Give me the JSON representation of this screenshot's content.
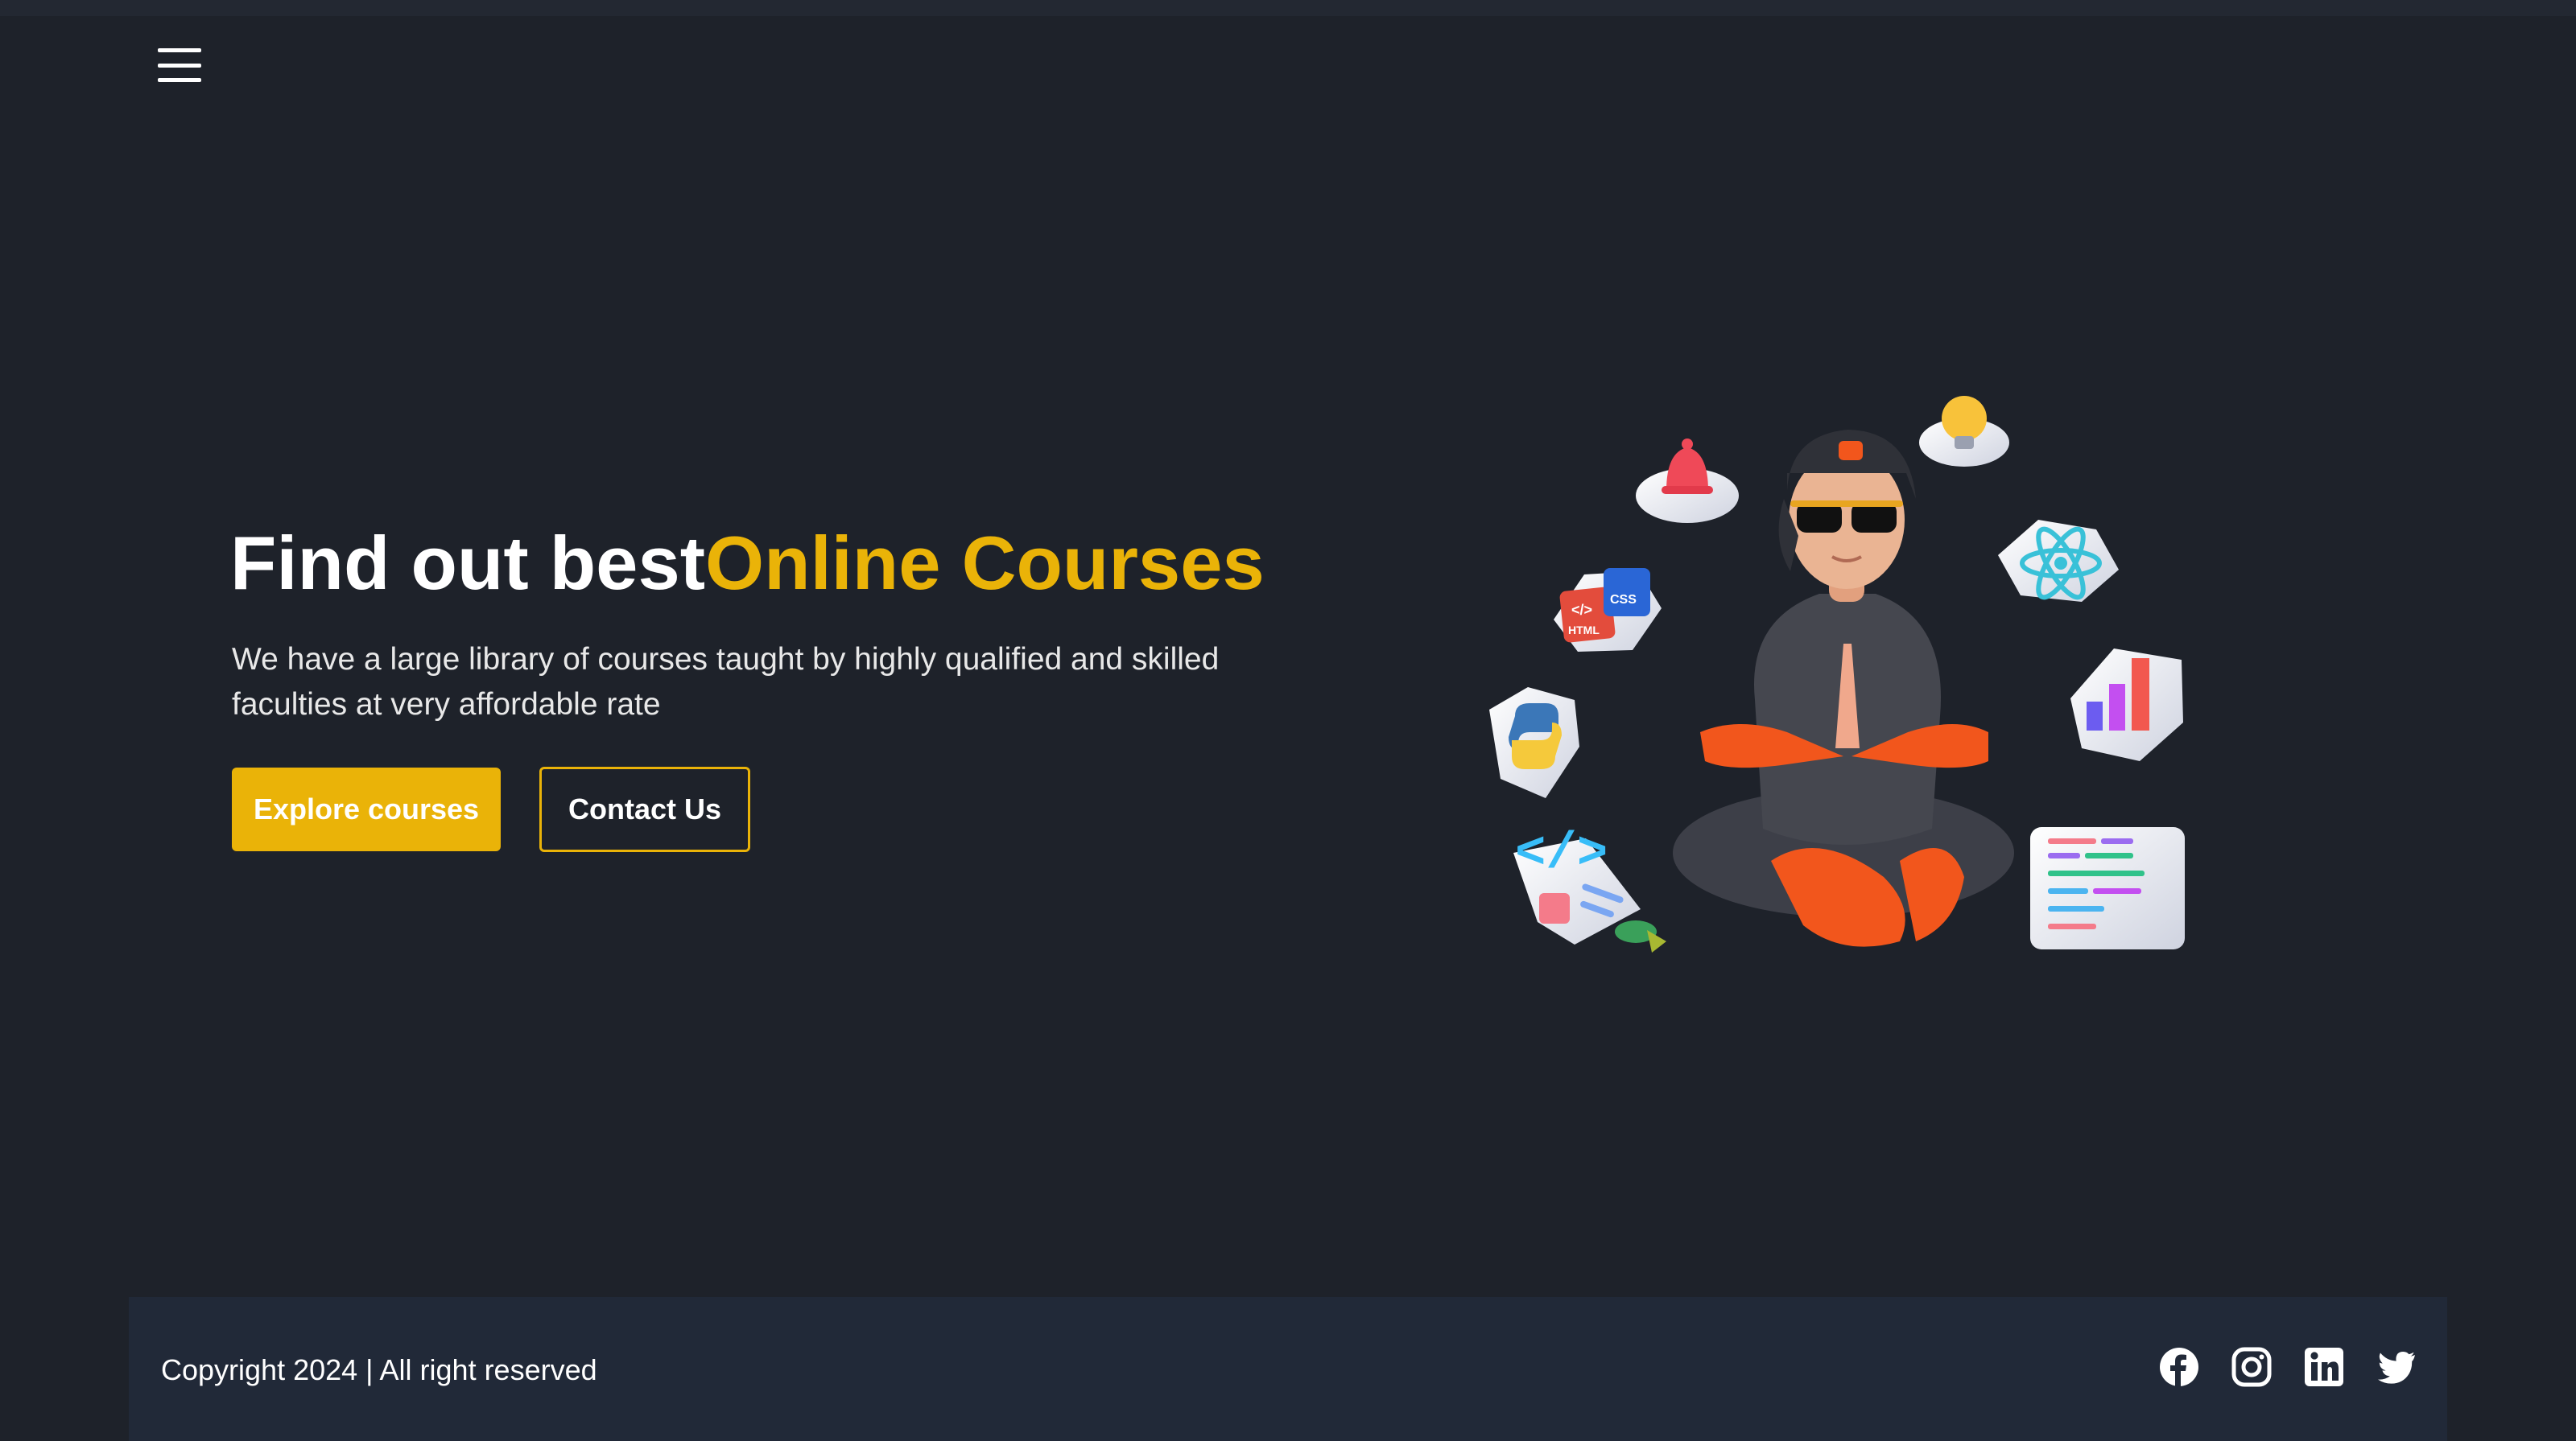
{
  "nav": {
    "menu_icon": "hamburger-icon"
  },
  "hero": {
    "title_plain": "Find out best",
    "title_accent": "Online Courses",
    "description": "We have a large library of courses taught by highly qualified and skilled faculties at very affordable rate",
    "primary_button": "Explore courses",
    "secondary_button": "Contact Us",
    "illustration_badges": {
      "html": "HTML",
      "css": "CSS"
    }
  },
  "footer": {
    "copyright": "Copyright 2024 | All right reserved",
    "social_icons": [
      "facebook-icon",
      "instagram-icon",
      "linkedin-icon",
      "twitter-icon"
    ]
  },
  "colors": {
    "background": "#1e222a",
    "footer_background": "#212938",
    "accent": "#eab308",
    "text": "#ffffff"
  }
}
